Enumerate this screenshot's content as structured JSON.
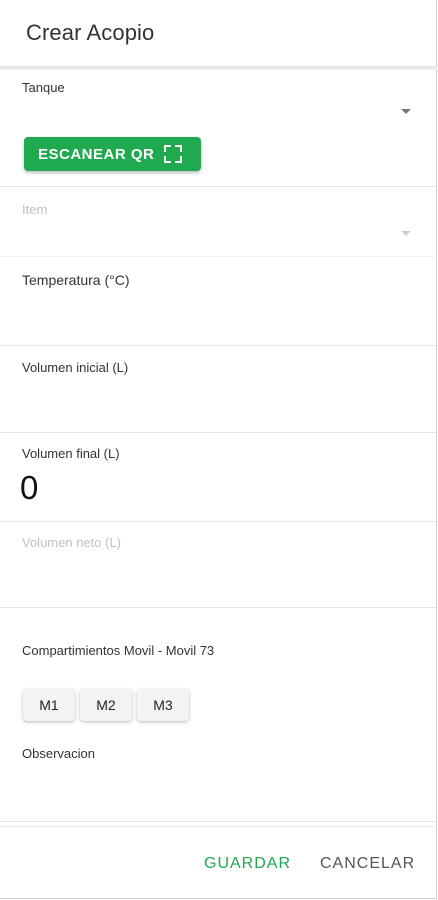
{
  "dialog": {
    "title": "Crear Acopio"
  },
  "fields": {
    "tanque": {
      "label": "Tanque",
      "value": ""
    },
    "scan_button": {
      "label": "ESCANEAR QR",
      "icon": "qr-scan-icon"
    },
    "item": {
      "label": "Item",
      "value": "",
      "disabled": true
    },
    "temperatura": {
      "label": "Temperatura (°C)",
      "value": ""
    },
    "volumen_inicial": {
      "label": "Volumen inicial (L)",
      "value": ""
    },
    "volumen_final": {
      "label": "Volumen final (L)",
      "value": "0"
    },
    "volumen_neto": {
      "label": "Volumen neto (L)",
      "value": "",
      "disabled": true
    },
    "compartimientos": {
      "label": "Compartimientos Movil - Movil 73",
      "buttons": [
        "M1",
        "M2",
        "M3"
      ]
    },
    "observacion": {
      "label": "Observacion",
      "value": ""
    }
  },
  "actions": {
    "save_label": "GUARDAR",
    "cancel_label": "CANCELAR"
  },
  "colors": {
    "accent": "#1faa4f",
    "disabled_text": "#c0c0c0"
  }
}
